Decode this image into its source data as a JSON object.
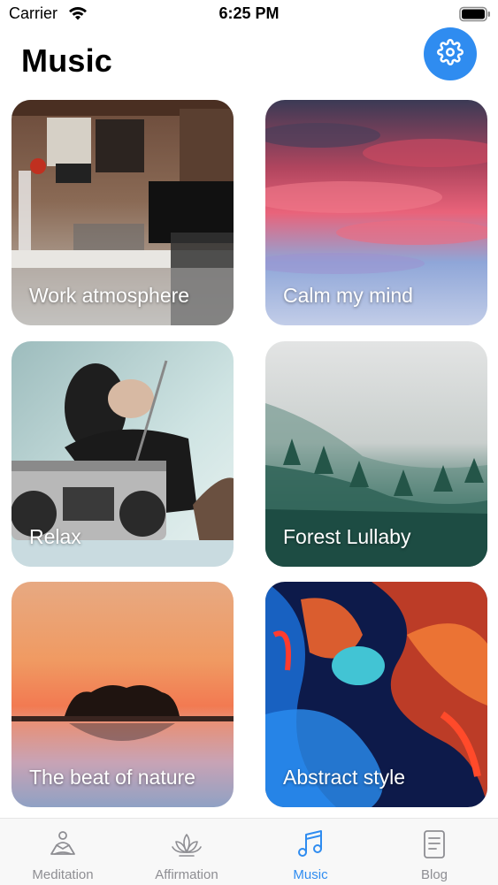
{
  "status_bar": {
    "carrier": "Carrier",
    "time": "6:25 PM"
  },
  "header": {
    "title": "Music",
    "settings_icon": "gear-icon",
    "accent_color": "#2f8cf0"
  },
  "cards": [
    {
      "label": "Work atmosphere",
      "image": "office-desk-photo"
    },
    {
      "label": "Calm my mind",
      "image": "pink-sunset-clouds-photo"
    },
    {
      "label": "Relax",
      "image": "person-with-boombox-photo"
    },
    {
      "label": "Forest Lullaby",
      "image": "misty-forest-photo"
    },
    {
      "label": "The beat of nature",
      "image": "lake-island-sunset-photo"
    },
    {
      "label": "Abstract style",
      "image": "colorful-ink-abstract-photo"
    }
  ],
  "tab_bar": {
    "tabs": [
      {
        "label": "Meditation",
        "icon": "meditation-icon"
      },
      {
        "label": "Affirmation",
        "icon": "lotus-icon"
      },
      {
        "label": "Music",
        "icon": "music-note-icon",
        "active": true
      },
      {
        "label": "Blog",
        "icon": "document-icon"
      }
    ],
    "active_color": "#2f8cf0",
    "inactive_color": "#8e8e93"
  }
}
